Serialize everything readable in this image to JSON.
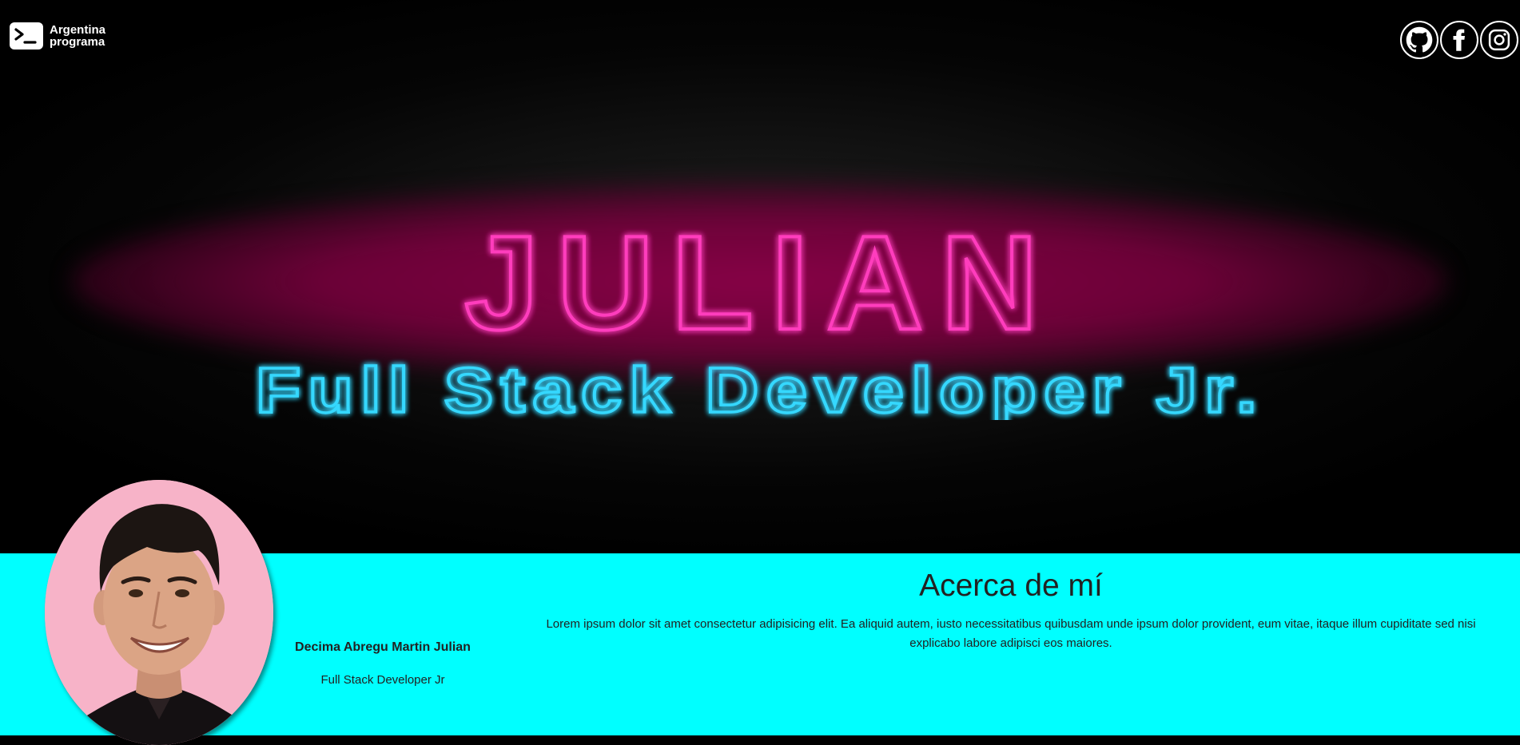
{
  "brand": {
    "line1": "Argentina",
    "line2": "programa"
  },
  "hero": {
    "name": "JULIAN",
    "subtitle": "Full Stack Developer Jr."
  },
  "socials": [
    {
      "icon": "github-icon"
    },
    {
      "icon": "facebook-icon"
    },
    {
      "icon": "instagram-icon"
    }
  ],
  "profile": {
    "name": "Decima Abregu Martin Julian",
    "role": "Full Stack Developer Jr"
  },
  "about": {
    "title": "Acerca de mí",
    "text": "Lorem ipsum dolor sit amet consectetur adipisicing elit. Ea aliquid autem, iusto necessitatibus quibusdam unde ipsum dolor provident, eum vitae, itaque illum cupiditate sed nisi explicabo labore adipisci eos maiores."
  },
  "colors": {
    "band": "#00ffff",
    "neon_pink": "#ff2fb4",
    "neon_blue": "#2fd2ff",
    "glow": "#8c0048"
  }
}
